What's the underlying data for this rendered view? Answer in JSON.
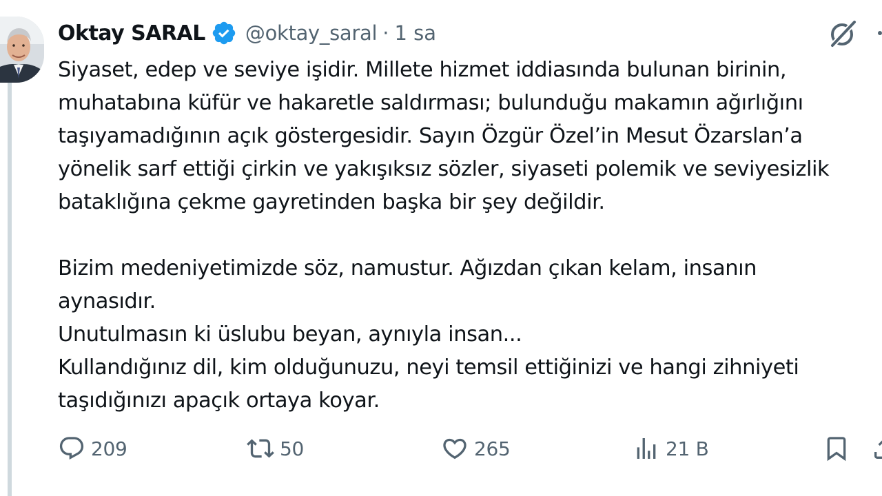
{
  "author": {
    "display_name": "Oktay SARAL",
    "handle": "@oktay_saral",
    "separator": "·",
    "time": "1 sa",
    "verified": true,
    "verified_color": "#1d9bf0"
  },
  "post": {
    "paragraphs": [
      "Siyaset, edep ve seviye işidir. Millete hizmet iddiasında bulunan birinin,",
      "muhatabına küfür ve hakaretle saldırması; bulunduğu makamın ağırlığını",
      "taşıyamadığının açık göstergesidir. Sayın Özgür Özel’in Mesut Özarslan’a",
      "yönelik sarf ettiği çirkin ve yakışıksız sözler, siyaseti polemik ve seviyesizlik",
      "bataklığına çekme gayretinden başka bir şey değildir.",
      "",
      "Bizim medeniyetimizde söz, namustur. Ağızdan çıkan kelam, insanın",
      "aynasıdır.",
      "Unutulmasın ki üslubu beyan, aynıyla insan...",
      "Kullandığınız dil, kim olduğunuzu, neyi temsil ettiğinizi ve hangi zihniyeti",
      "taşıdığınızı apaçık ortaya koyar."
    ]
  },
  "actions": {
    "reply": {
      "icon": "reply-icon",
      "count": "209"
    },
    "retweet": {
      "icon": "retweet-icon",
      "count": "50"
    },
    "like": {
      "icon": "heart-icon",
      "count": "265"
    },
    "views": {
      "icon": "views-icon",
      "count": "21 B"
    },
    "bookmark": {
      "icon": "bookmark-icon"
    },
    "share": {
      "icon": "share-icon"
    }
  },
  "top_icons": {
    "grok": "grok-icon",
    "more": "more-icon"
  },
  "colors": {
    "text": "#0f1419",
    "secondary": "#536471",
    "thread_line": "#cfd9de",
    "accent": "#1d9bf0"
  }
}
